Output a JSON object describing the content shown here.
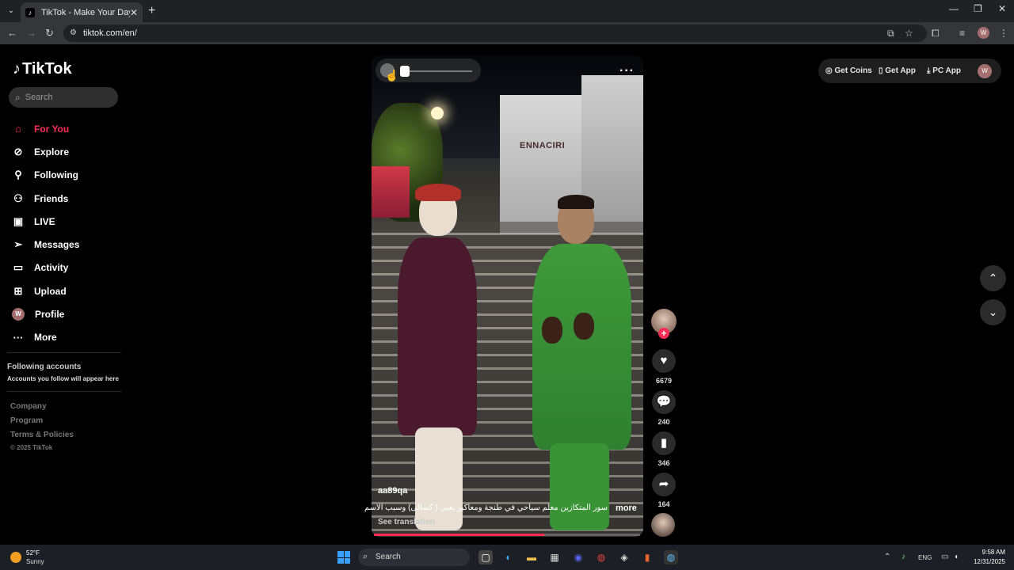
{
  "browser": {
    "tab_title": "TikTok - Make Your Day",
    "url": "tiktok.com/en/",
    "profile_initial": "W"
  },
  "sidebar": {
    "logo_text": "TikTok",
    "search_placeholder": "Search",
    "nav": [
      {
        "label": "For You",
        "icon": "home-icon",
        "active": true
      },
      {
        "label": "Explore",
        "icon": "compass-icon"
      },
      {
        "label": "Following",
        "icon": "person-follow-icon"
      },
      {
        "label": "Friends",
        "icon": "friends-icon"
      },
      {
        "label": "LIVE",
        "icon": "live-icon"
      },
      {
        "label": "Messages",
        "icon": "send-icon"
      },
      {
        "label": "Activity",
        "icon": "activity-icon"
      },
      {
        "label": "Upload",
        "icon": "upload-icon"
      },
      {
        "label": "Profile",
        "icon": "avatar",
        "initial": "W"
      },
      {
        "label": "More",
        "icon": "more-dots-icon"
      }
    ],
    "following_accounts_title": "Following accounts",
    "following_accounts_sub": "Accounts you follow will appear here",
    "footer_links": [
      "Company",
      "Program",
      "Terms & Policies"
    ],
    "copyright": "© 2025 TikTok"
  },
  "video": {
    "author": "aa89qa",
    "caption": "سور المتكازين معلم سياحي في طنجة ومعاكيز يعني ( كسالى)  وسبب الاسم",
    "more_label": "more",
    "see_translation": "See translation",
    "progress": 0.64
  },
  "actions": {
    "likes": "6679",
    "comments": "240",
    "bookmarks": "346",
    "shares": "164"
  },
  "top_right": {
    "get_coins": "Get Coins",
    "get_app": "Get App",
    "pc_app": "PC App",
    "avatar_initial": "W"
  },
  "taskbar": {
    "temperature": "52°F",
    "weather": "Sunny",
    "search_label": "Search",
    "language": "ENG",
    "time": "9:58 AM",
    "date": "12/31/2025"
  }
}
